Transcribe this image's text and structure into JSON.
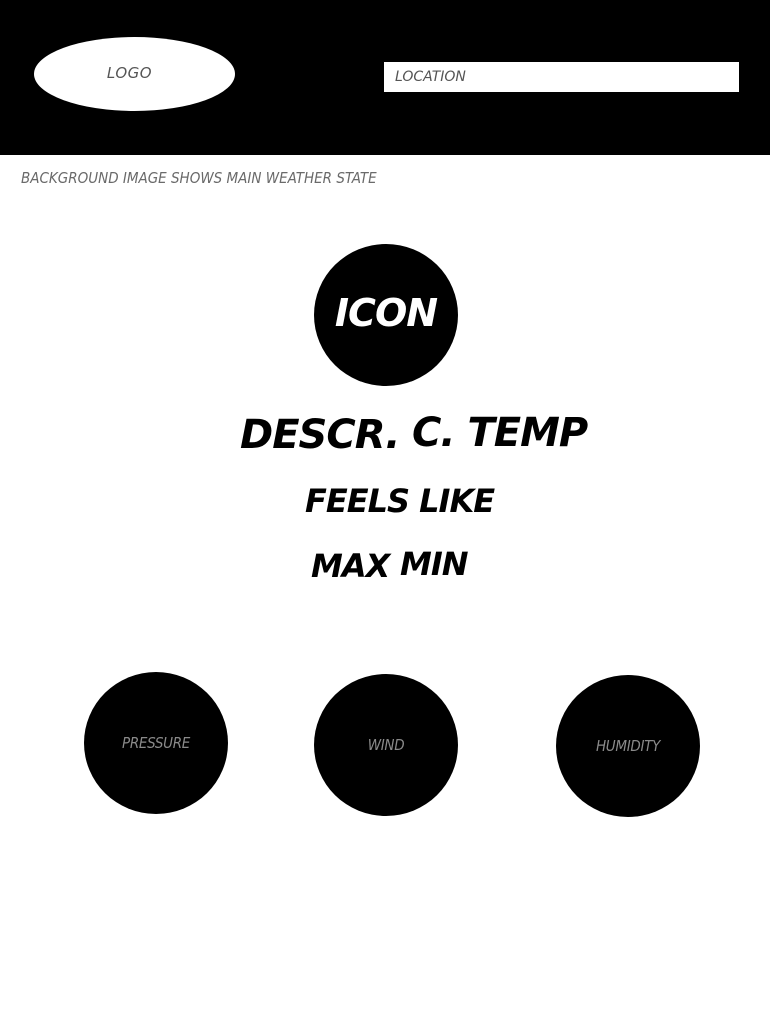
{
  "header": {
    "logo_label": "LOGO",
    "location_placeholder": "LOCATION"
  },
  "note": "BACKGROUND IMAGE SHOWS MAIN WEATHER STATE",
  "weather": {
    "icon_label": "ICON",
    "description": "DESCR.",
    "current_temp": "C. TEMP",
    "feels_like": "FEELS LIKE",
    "max": "MAX",
    "min": "MIN"
  },
  "stats": {
    "pressure": "PRESSURE",
    "wind": "WIND",
    "humidity": "HUMIDITY"
  },
  "colors": {
    "header_bg": "#000000",
    "page_bg": "#ffffff",
    "circle_bg": "#000000"
  }
}
